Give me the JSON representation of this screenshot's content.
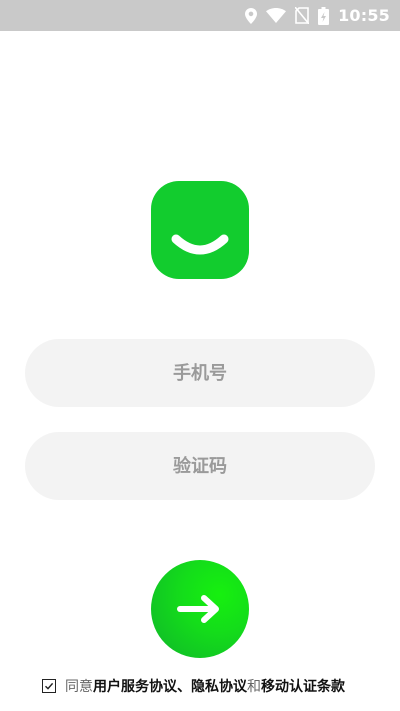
{
  "status_bar": {
    "time": "10:55",
    "icons": [
      "location-icon",
      "wifi-icon",
      "no-sim-icon",
      "battery-charging-icon"
    ]
  },
  "logo": {
    "icon": "smile-icon",
    "color": "#12cc2e"
  },
  "form": {
    "phone_placeholder": "手机号",
    "phone_value": "",
    "code_placeholder": "验证码",
    "code_value": ""
  },
  "submit": {
    "icon": "arrow-right-icon",
    "colors": [
      "#16f00f",
      "#0fb52b"
    ]
  },
  "agreement": {
    "checked": true,
    "prefix": "同意",
    "link_user_service": "用户服务协议",
    "separator": "、",
    "link_privacy": "隐私协议",
    "conjunction": "和",
    "link_mobile_auth": "移动认证条款"
  }
}
